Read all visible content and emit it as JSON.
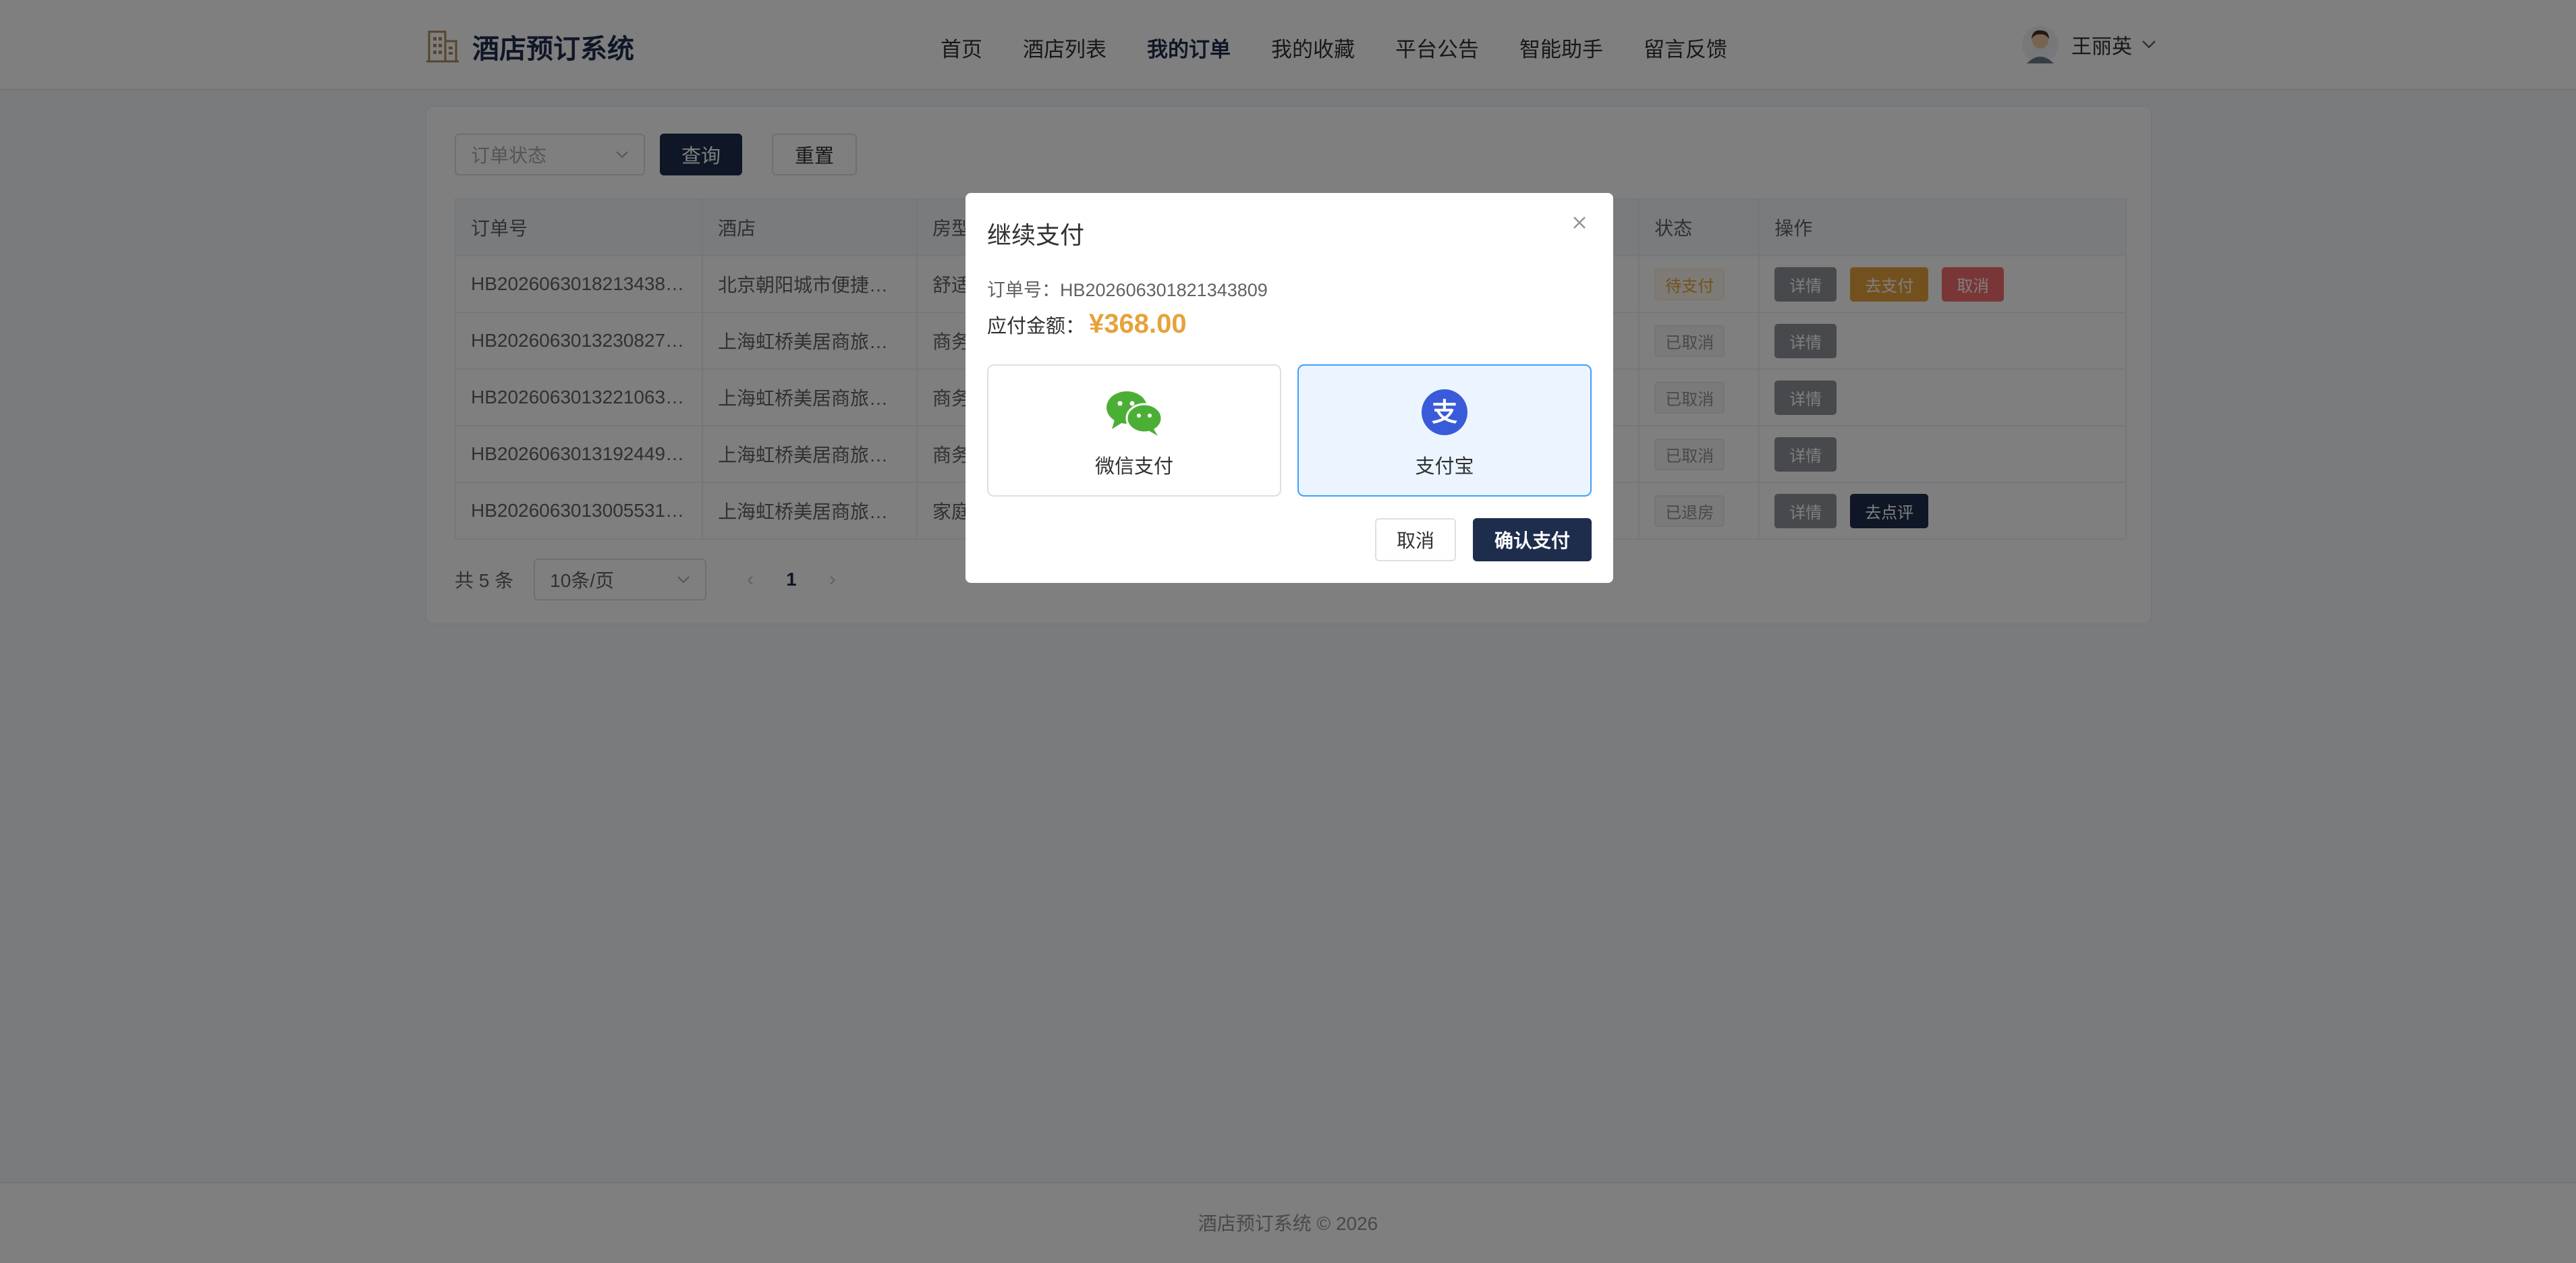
{
  "app": {
    "title": "酒店预订系统"
  },
  "nav": {
    "items": [
      {
        "label": "首页"
      },
      {
        "label": "酒店列表"
      },
      {
        "label": "我的订单"
      },
      {
        "label": "我的收藏"
      },
      {
        "label": "平台公告"
      },
      {
        "label": "智能助手"
      },
      {
        "label": "留言反馈"
      }
    ],
    "active": "我的订单"
  },
  "user": {
    "name": "王丽英"
  },
  "filters": {
    "status_placeholder": "订单状态",
    "query_label": "查询",
    "reset_label": "重置"
  },
  "table": {
    "columns": [
      "订单号",
      "酒店",
      "房型",
      "状态",
      "操作"
    ],
    "rows": [
      {
        "order_no": "HB2026063018213438…",
        "hotel": "北京朝阳城市便捷…",
        "room": "舒适",
        "status": "待支付",
        "actions": [
          "详情",
          "去支付",
          "取消"
        ]
      },
      {
        "order_no": "HB2026063013230827…",
        "hotel": "上海虹桥美居商旅…",
        "room": "商务",
        "status": "已取消",
        "actions": [
          "详情"
        ]
      },
      {
        "order_no": "HB2026063013221063…",
        "hotel": "上海虹桥美居商旅…",
        "room": "商务",
        "status": "已取消",
        "actions": [
          "详情"
        ]
      },
      {
        "order_no": "HB2026063013192449…",
        "hotel": "上海虹桥美居商旅…",
        "room": "商务",
        "status": "已取消",
        "actions": [
          "详情"
        ]
      },
      {
        "order_no": "HB2026063013005531…",
        "hotel": "上海虹桥美居商旅…",
        "room": "家庭",
        "status": "已退房",
        "actions": [
          "详情",
          "去点评"
        ]
      }
    ]
  },
  "pagination": {
    "total_label": "共 5 条",
    "page_size": "10条/页",
    "current_page": "1"
  },
  "footer": {
    "text": "酒店预订系统 © 2026"
  },
  "modal": {
    "title": "继续支付",
    "order_label": "订单号：HB202606301821343809",
    "amount_label": "应付金额：",
    "amount": "¥368.00",
    "options": [
      {
        "label": "微信支付",
        "icon": "wechat-pay-icon",
        "selected": false
      },
      {
        "label": "支付宝",
        "icon": "alipay-icon",
        "selected": true
      }
    ],
    "cancel_label": "取消",
    "confirm_label": "确认支付"
  },
  "colors": {
    "brand": "#1f2d4d",
    "warning": "#e6a23c",
    "danger": "#f56c6c",
    "wechat_green": "#4caf35",
    "alipay_blue": "#3a5bd9",
    "selected_border": "#409eff"
  }
}
